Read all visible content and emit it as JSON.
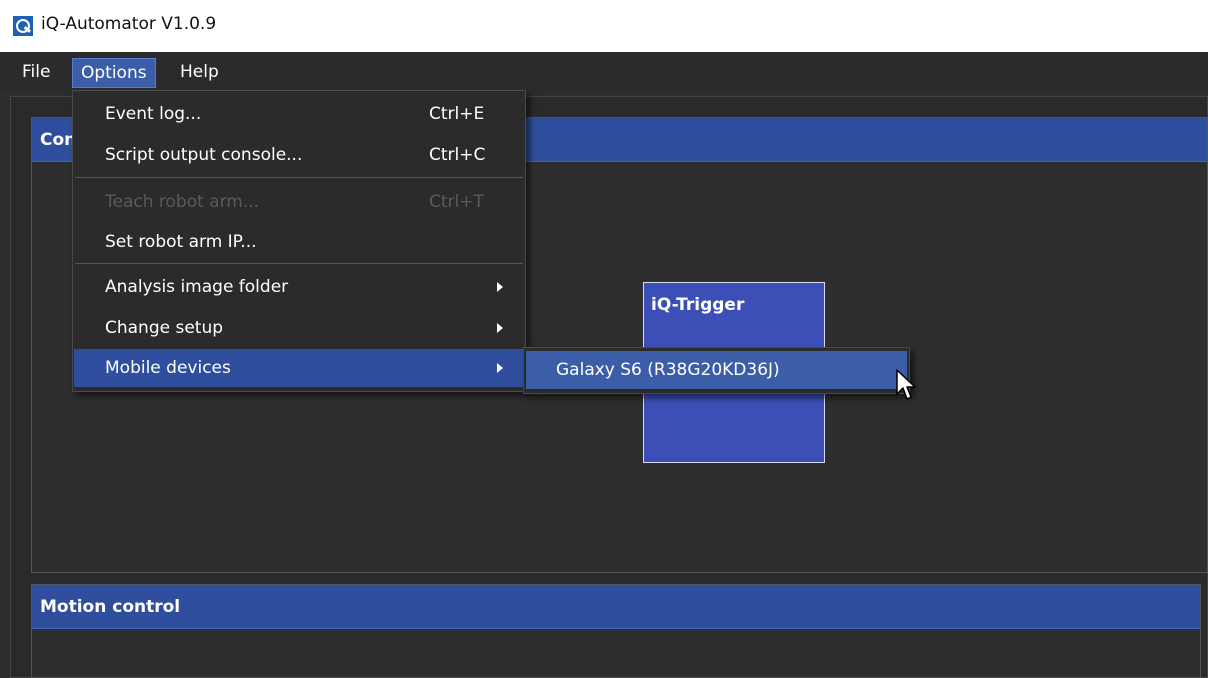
{
  "window": {
    "title": "iQ-Automator V1.0.9",
    "icon": "app-logo-icon"
  },
  "menubar": {
    "items": [
      "File",
      "Options",
      "Help"
    ],
    "active": "Options"
  },
  "options_menu": {
    "items": [
      {
        "label": "Event log...",
        "shortcut": "Ctrl+E"
      },
      {
        "label": "Script output console...",
        "shortcut": "Ctrl+C"
      },
      {
        "label": "Teach robot arm...",
        "shortcut": "Ctrl+T",
        "disabled": true
      },
      {
        "label": "Set robot arm IP..."
      },
      {
        "label": "Analysis image folder",
        "submenu": true
      },
      {
        "label": "Change setup",
        "submenu": true
      },
      {
        "label": "Mobile devices",
        "submenu": true,
        "highlighted": true
      }
    ]
  },
  "mobile_devices_submenu": {
    "items": [
      "Galaxy S6 (R38G20KD36J)"
    ]
  },
  "panels": {
    "top_header": "Con",
    "trigger_label": "iQ-Trigger",
    "bottom_header": "Motion control"
  },
  "colors": {
    "accent": "#2f4f9e",
    "highlight": "#3c5ea8",
    "trigger_box": "#3c4fb6",
    "background": "#2d2d2d"
  }
}
